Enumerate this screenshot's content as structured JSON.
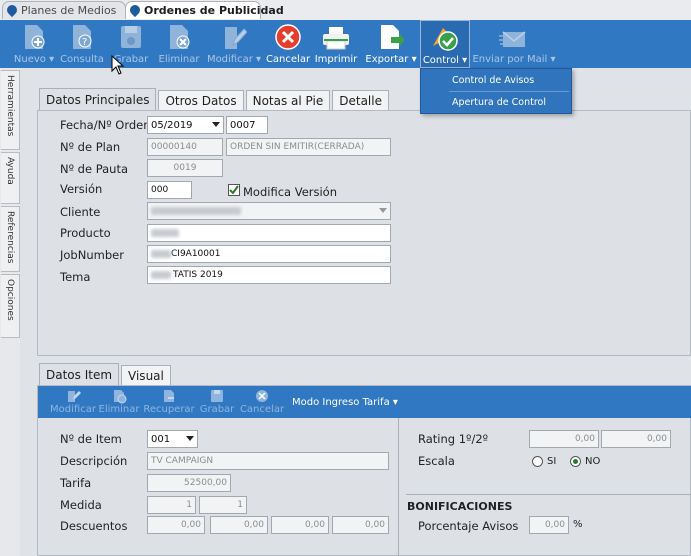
{
  "doc_tabs": [
    {
      "label": "Planes de Medios"
    },
    {
      "label": "Ordenes de Publicidad"
    }
  ],
  "toolbar": {
    "nuevo": "Nuevo",
    "consulta": "Consulta",
    "grabar": "Grabar",
    "eliminar": "Eliminar",
    "modificar": "Modificar",
    "cancelar": "Cancelar",
    "imprimir": "Imprimir",
    "exportar": "Exportar",
    "control": "Control",
    "enviar_mail": "Enviar por Mail"
  },
  "control_menu": {
    "items": [
      "Control de Avisos",
      "Apertura de Control"
    ]
  },
  "sidebar": {
    "tabs": [
      "Herramientas",
      "Ayuda",
      "Referencias",
      "Opciones"
    ]
  },
  "main_tabs": [
    "Datos Principales",
    "Otros Datos",
    "Notas al Pie",
    "Detalle"
  ],
  "form": {
    "fecha_label": "Fecha/Nº Orden",
    "fecha_value": "05/2019",
    "orden_value": "0007",
    "plan_label": "Nº de Plan",
    "plan_value": "00000140",
    "plan_status": "ORDEN SIN EMITIR(CERRADA)",
    "pauta_label": "Nº de Pauta",
    "pauta_value": "0019",
    "version_label": "Versión",
    "version_value": "000",
    "modifica_label": "Modifica Versión",
    "cliente_label": "Cliente",
    "producto_label": "Producto",
    "jobnumber_label": "JobNumber",
    "jobnumber_value": "CI9A10001",
    "tema_label": "Tema",
    "tema_value": "TATIS 2019"
  },
  "item_tabs": [
    "Datos Item",
    "Visual"
  ],
  "item_toolbar": {
    "modificar": "Modificar",
    "eliminar": "Eliminar",
    "recuperar": "Recuperar",
    "grabar": "Grabar",
    "cancelar": "Cancelar",
    "modo": "Modo Ingreso Tarifa"
  },
  "item": {
    "nitem_label": "Nº de Item",
    "nitem_value": "001",
    "descripcion_label": "Descripción",
    "descripcion_value": "TV CAMPAIGN",
    "tarifa_label": "Tarifa",
    "tarifa_value": "52500,00",
    "medida_label": "Medida",
    "medida_1": "1",
    "medida_2": "1",
    "descuentos_label": "Descuentos",
    "descuentos": [
      "0,00",
      "0,00",
      "0,00",
      "0,00"
    ],
    "rating_label": "Rating 1º/2º",
    "rating_1": "0,00",
    "rating_2": "0,00",
    "escala_label": "Escala",
    "si_label": "SI",
    "no_label": "NO",
    "bonificaciones_title": "BONIFICACIONES",
    "porcentaje_label": "Porcentaje Avisos",
    "porcentaje_value": "0,00",
    "porcentaje_unit": "%"
  }
}
